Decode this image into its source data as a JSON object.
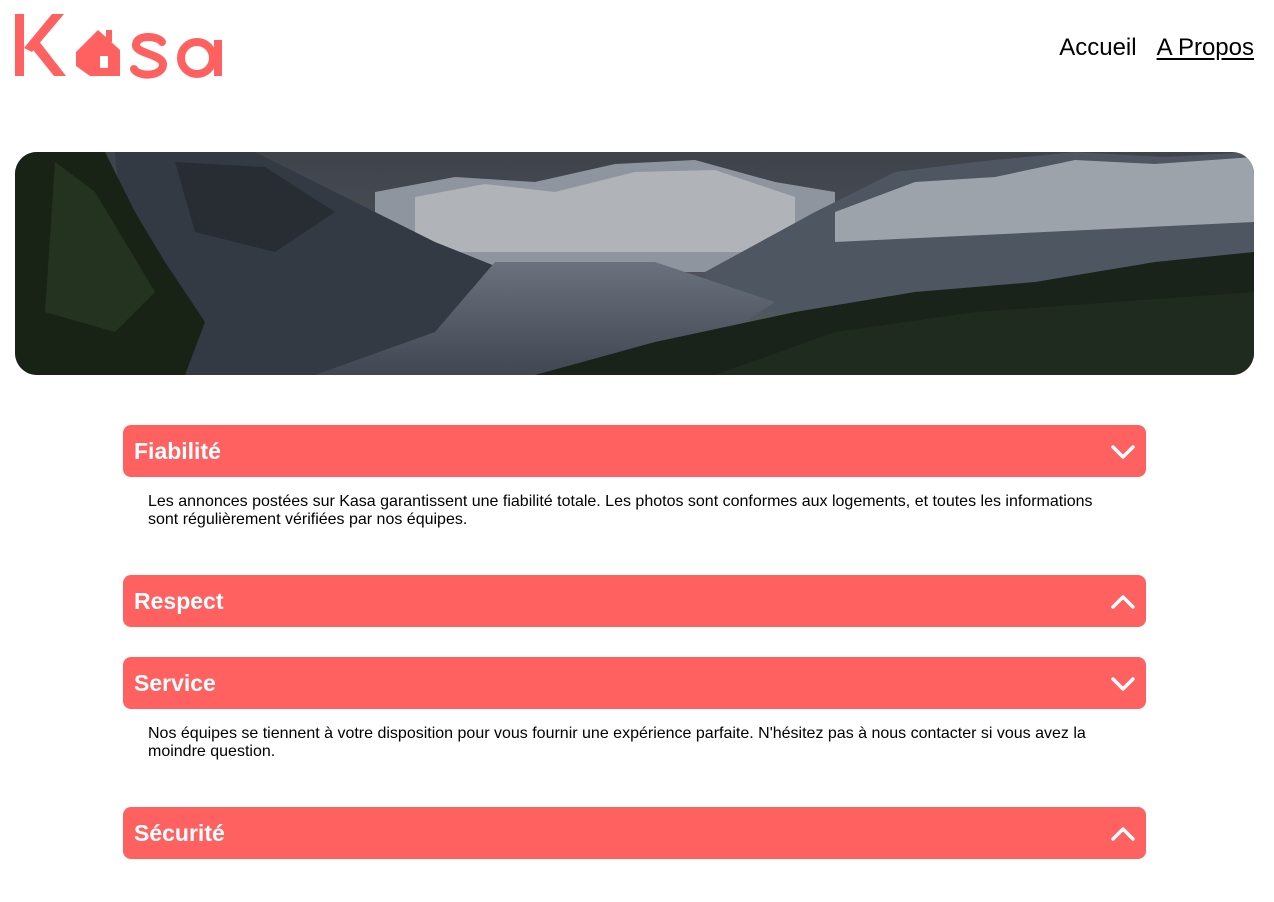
{
  "brand": {
    "name": "Kasa",
    "color": "#FF6060"
  },
  "nav": {
    "items": [
      {
        "label": "Accueil",
        "active": false
      },
      {
        "label": "A Propos",
        "active": true
      }
    ]
  },
  "accordion": [
    {
      "title": "Fiabilité",
      "open": true,
      "icon": "chevron-down-icon",
      "content": "Les annonces postées sur Kasa garantissent une fiabilité totale. Les photos sont conformes aux logements, et toutes les informations sont régulièrement vérifiées par nos équipes."
    },
    {
      "title": "Respect",
      "open": false,
      "icon": "chevron-up-icon",
      "content": ""
    },
    {
      "title": "Service",
      "open": true,
      "icon": "chevron-down-icon",
      "content": "Nos équipes se tiennent à votre disposition pour vous fournir une expérience parfaite. N'hésitez pas à nous contacter si vous avez la moindre question."
    },
    {
      "title": "Sécurité",
      "open": false,
      "icon": "chevron-up-icon",
      "content": ""
    }
  ]
}
